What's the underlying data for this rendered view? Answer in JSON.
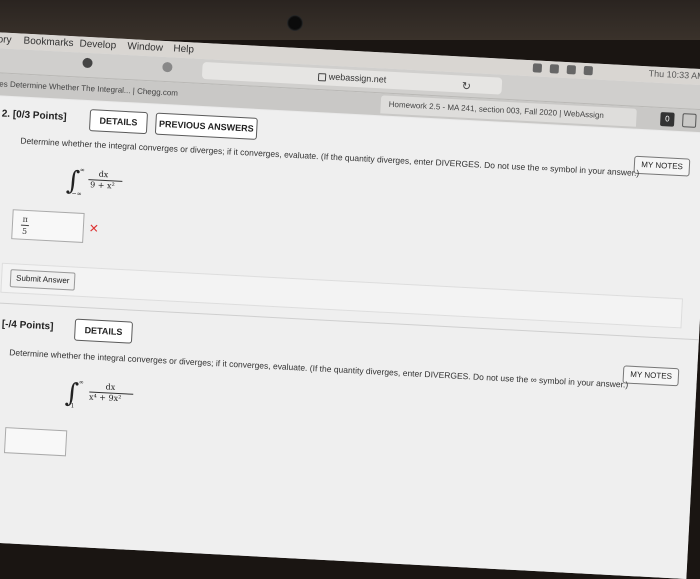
{
  "menubar": {
    "items": [
      "ory",
      "Bookmarks",
      "Develop",
      "Window",
      "Help"
    ],
    "clock": "Thu 10:33 AM"
  },
  "browser": {
    "url": "webassign.net",
    "tab_left": "es Determine Whether The Integral... | Chegg.com",
    "tab_active": "Homework 2.5 - MA 241, section 003, Fall 2020 | WebAssign",
    "tab_count": "0"
  },
  "questions": [
    {
      "header": "2. [0/3 Points]",
      "details_label": "DETAILS",
      "prev_answers_label": "PREVIOUS ANSWERS",
      "mynotes_label": "MY NOTES",
      "text": "Determine whether the integral converges or diverges; if it converges, evaluate. (If the quantity diverges, enter DIVERGES. Do not use the ∞ symbol in your answer.)",
      "integral": {
        "upper": "∞",
        "lower": "−∞",
        "numerator": "dx",
        "denominator": "9 + x²"
      },
      "answer": {
        "num": "π",
        "den": "5"
      },
      "status": "✕",
      "submit_label": "Submit Answer"
    },
    {
      "header": "3. [-/4 Points]",
      "details_label": "DETAILS",
      "mynotes_label": "MY NOTES",
      "text": "Determine whether the integral converges or diverges; if it converges, evaluate. (If the quantity diverges, enter DIVERGES. Do not use the ∞ symbol in your answer.)",
      "integral": {
        "upper": "∞",
        "lower": "1",
        "numerator": "dx",
        "denominator": "x⁴ + 9x²"
      }
    }
  ]
}
